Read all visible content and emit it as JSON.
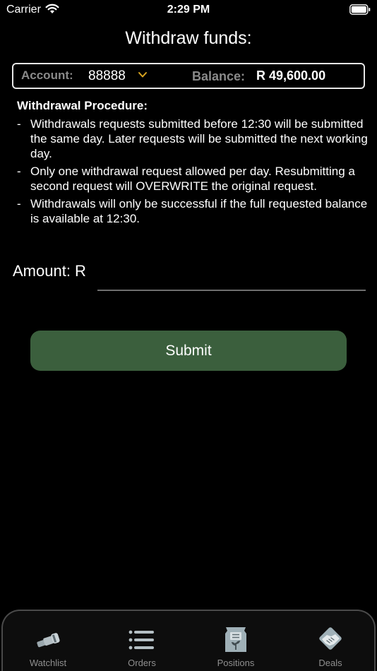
{
  "status_bar": {
    "carrier": "Carrier",
    "time": "2:29 PM"
  },
  "title": "Withdraw funds:",
  "account": {
    "label": "Account:",
    "value": "88888",
    "balance_label": "Balance:",
    "balance_value": "R 49,600.00"
  },
  "procedure": {
    "heading": "Withdrawal Procedure:",
    "items": [
      "Withdrawals requests submitted before 12:30 will be submitted the same day. Later requests will be submitted the next working day.",
      "Only one withdrawal request allowed per day. Resubmitting a second request will OVERWRITE the original request.",
      "Withdrawals will only be successful if the full requested balance is available at 12:30."
    ]
  },
  "amount": {
    "label": "Amount: R",
    "value": "",
    "placeholder": ""
  },
  "submit_label": "Submit",
  "tabs": [
    {
      "label": "Watchlist",
      "icon": "telescope-icon"
    },
    {
      "label": "Orders",
      "icon": "list-icon"
    },
    {
      "label": "Positions",
      "icon": "seed-bag-icon"
    },
    {
      "label": "Deals",
      "icon": "handshake-icon"
    }
  ],
  "colors": {
    "background": "#000000",
    "accent_chevron": "#d9a520",
    "submit_bg": "#3b5f3d",
    "muted_label": "#8a8a8a",
    "tab_label": "#8f8f8f"
  }
}
